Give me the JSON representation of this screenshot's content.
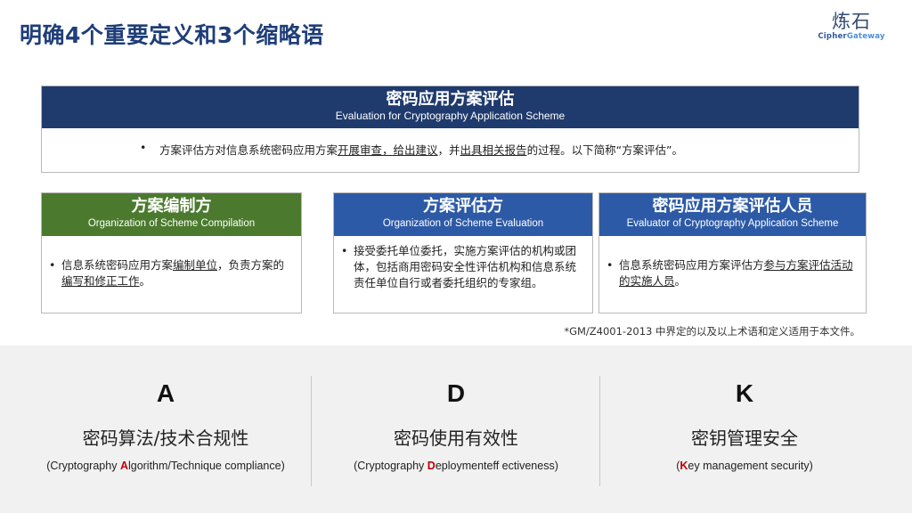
{
  "page_title": "明确4个重要定义和3个缩略语",
  "logo": {
    "cn": "炼石",
    "en_part1": "Cipher",
    "en_part2": "Gateway"
  },
  "main_def": {
    "title_cn": "密码应用方案评估",
    "title_en": "Evaluation for Cryptography Application Scheme",
    "bullet": "•",
    "desc_1": "方案评估方对信息系统密码应用方案",
    "desc_u1": "开展审查，给出建议",
    "desc_2": "，并",
    "desc_u2": "出具相关报告",
    "desc_3": "的过程。以下简称“方案评估”。"
  },
  "def_compile": {
    "title_cn": "方案编制方",
    "title_en": "Organization of  Scheme Compilation",
    "bullet": "•",
    "desc_1": "信息系统密码应用方案",
    "desc_u1": "编制单位",
    "desc_2": "，负责方案的",
    "desc_u2": "编写和修正工作",
    "desc_3": "。"
  },
  "def_eval": {
    "title_cn": "方案评估方",
    "title_en": "Organization of  Scheme Evaluation",
    "bullet": "•",
    "desc": "接受委托单位委托，实施方案评估的机构或团体，包括商用密码安全性评估机构和信息系统责任单位自行或者委托组织的专家组。"
  },
  "def_person": {
    "title_cn": "密码应用方案评估人员",
    "title_en": "Evaluator of Cryptography Application Scheme",
    "bullet": "•",
    "desc_1": "信息系统密码应用方案评估方",
    "desc_u1": "参与方案评估活动的实施人员",
    "desc_2": "。"
  },
  "note": "*GM/Z4001-2013 中界定的以及以上术语和定义适用于本文件。",
  "abbrevs": {
    "a": {
      "letter": "A",
      "cn": "密码算法/技术合规性",
      "en_pre": "(Cryptography ",
      "en_hl": "A",
      "en_post": "lgorithm/Technique compliance)"
    },
    "d": {
      "letter": "D",
      "cn": "密码使用有效性",
      "en_pre": "(Cryptography ",
      "en_hl": "D",
      "en_post": "eploymenteff ectiveness)"
    },
    "k": {
      "letter": "K",
      "cn": "密钥管理安全",
      "en_pre": "(",
      "en_hl": "K",
      "en_post": "ey management security)"
    }
  }
}
